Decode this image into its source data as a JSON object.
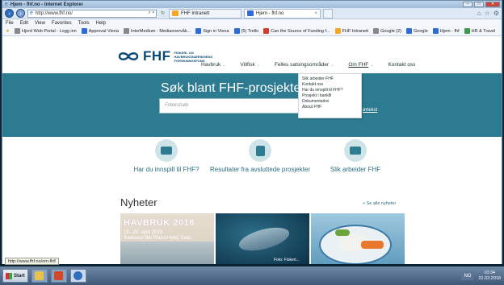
{
  "window": {
    "title": "Hjem - fhf.no - Internet Explorer",
    "controls": [
      "–",
      "□",
      "✕"
    ]
  },
  "navbar": {
    "address": "http://www.fhf.no/",
    "tabs": [
      {
        "label": "FHF Intranett"
      },
      {
        "label": "Hjem - fhf.no"
      }
    ]
  },
  "menubar": [
    "File",
    "Edit",
    "View",
    "Favorites",
    "Tools",
    "Help"
  ],
  "favorites": [
    {
      "label": "Hjord Web Portal - Logg inn",
      "color": "gray"
    },
    {
      "label": "Approval Viena",
      "color": "blue"
    },
    {
      "label": "InterMedium - Mediaovervåk...",
      "color": "gray"
    },
    {
      "label": "Sign in Viena",
      "color": "blue"
    },
    {
      "label": "(5) Trello",
      "color": "blue"
    },
    {
      "label": "Can the Source of Funding f...",
      "color": "red"
    },
    {
      "label": "FHF Intranett",
      "color": "orange"
    },
    {
      "label": "Google (2)",
      "color": "gray"
    },
    {
      "label": "Google",
      "color": "blue"
    },
    {
      "label": "Hjem - fhf",
      "color": "blue"
    },
    {
      "label": "HR & Travel",
      "color": "green"
    }
  ],
  "site": {
    "logo_text": "FHF",
    "logo_sub": "FISKERI- OG HAVBRUKSNÆRINGENS FORSKNINGSFOND",
    "nav": [
      {
        "label": "Havbruk"
      },
      {
        "label": "Villfisk"
      },
      {
        "label": "Felles satsingsområder"
      },
      {
        "label": "Om FHF"
      },
      {
        "label": "Kontakt oss"
      }
    ],
    "dropdown": [
      "Slik arbeider FHF",
      "Kontakt oss",
      "Har du innspill til FHF?",
      "Prosjekt i bankfil",
      "Dokumentarkiv",
      "About FHF"
    ],
    "hero_title": "Søk blant FHF-prosjekter",
    "search_placeholder": "Fritekstsøk",
    "hero_link": "ørtekst",
    "features": [
      {
        "label": "Har du innspill til FHF?"
      },
      {
        "label": "Resultater fra avsluttede prosjekter"
      },
      {
        "label": "Slik arbeider FHF"
      }
    ],
    "news_title": "Nyheter",
    "news_all": "» Se alle nyheter",
    "card1": {
      "headline": "HAVBRUK 2018",
      "dates": "18.–20. april 2018",
      "venue": "Radisson Blu Plaza Hotel, Oslo"
    },
    "card2_caption": "Foto: Fiskeri..."
  },
  "status_url": "http://www.fhf.no/om-fhf/",
  "taskbar": {
    "start_label": "Start",
    "lang": "NO",
    "time": "10:34",
    "date": "21.03.2018"
  }
}
